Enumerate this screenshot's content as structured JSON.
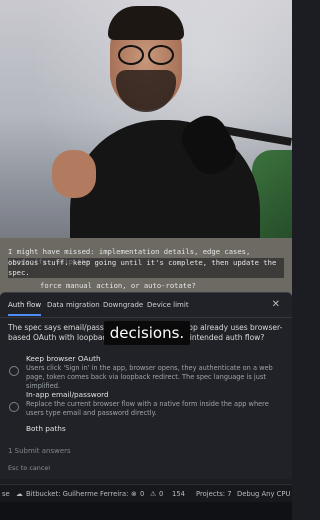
{
  "overlay": {
    "line1": "I might have missed: implementation details, edge cases, tradeoffs. Skip the",
    "line2": "obvious stuff. keep going until it's complete, then update the spec.",
    "line3": "force manual action, or auto-rotate?"
  },
  "caption": "decisions.",
  "dialog": {
    "tabs": [
      "Auth flow",
      "Data migration",
      "Downgrade",
      "Device limit"
    ],
    "active_tab": "Auth flow",
    "question": "The spec says email/password sign in, but the app already uses browser-based OAuth with loopback redirect. What's the intended auth flow?",
    "options": [
      {
        "title": "Keep browser OAuth",
        "desc": "Users click 'Sign in' in the app, browser opens, they authenticate on a web page, token comes back via loopback redirect. The spec language is just simplified."
      },
      {
        "title": "In-app email/password",
        "desc": "Replace the current browser flow with a native form inside the app where users type email and password directly."
      },
      {
        "title": "Both paths",
        "desc": ""
      }
    ],
    "submit_label": "1  Submit answers",
    "cancel_hint": "Esc to cancel"
  },
  "statusbar": {
    "left": "se",
    "bitbucket": "Bitbucket: Guilherme Ferreira:",
    "errors": "0",
    "warnings": "0",
    "count": "154",
    "projects": "Projects: 7",
    "config": "Debug Any CPU"
  },
  "icons": [
    "close-icon",
    "cloud-icon",
    "error-icon",
    "warning-icon",
    "radio-icon"
  ],
  "colors": {
    "accent": "#4f8ef7",
    "dialog_bg": "#202227",
    "status_bg": "#16181c"
  }
}
